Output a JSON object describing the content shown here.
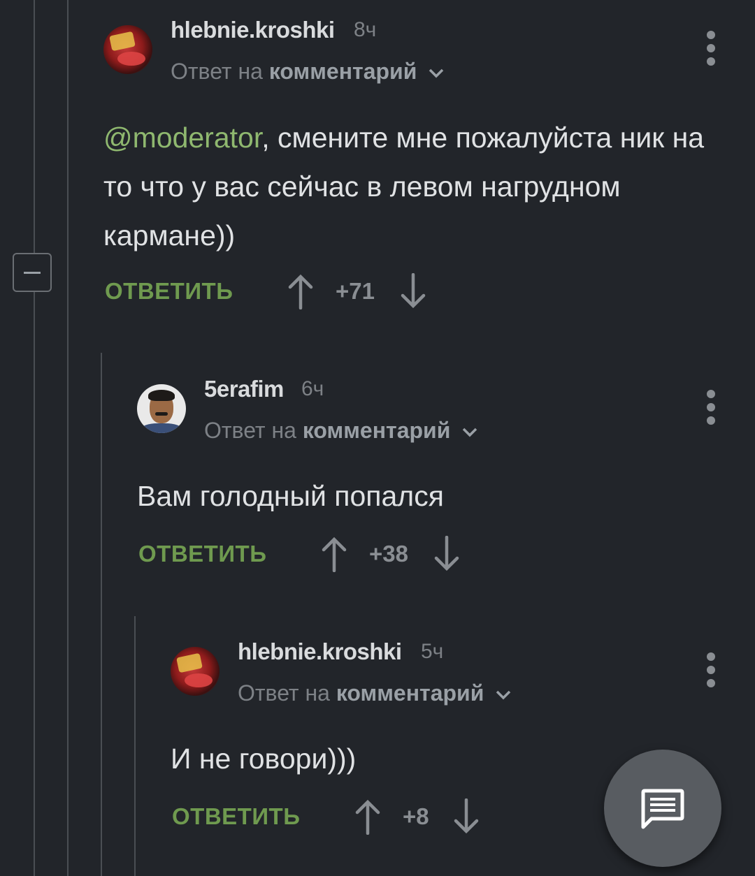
{
  "comments": [
    {
      "username": "hlebnie.kroshki",
      "time": "8ч",
      "reply_prefix": "Ответ на",
      "reply_target": "комментарий",
      "mention": "@moderator",
      "text": ", смените мне пожалуйста ник на то что у вас сейчас в левом нагрудном кармане))",
      "reply_label": "ОТВЕТИТЬ",
      "score": "+71",
      "avatar_icon": "noodle-avatar"
    },
    {
      "username": "5erafim",
      "time": "6ч",
      "reply_prefix": "Ответ на",
      "reply_target": "комментарий",
      "text": "Вам голодный попался",
      "reply_label": "ОТВЕТИТЬ",
      "score": "+38",
      "avatar_icon": "man-avatar"
    },
    {
      "username": "hlebnie.kroshki",
      "time": "5ч",
      "reply_prefix": "Ответ на",
      "reply_target": "комментарий",
      "text": "И не говори)))",
      "reply_label": "ОТВЕТИТЬ",
      "score": "+8",
      "avatar_icon": "noodle-avatar"
    }
  ],
  "colors": {
    "background": "#22252a",
    "accent_green": "#6f9a4f",
    "mention_green": "#8fb86f",
    "muted": "#7d8186"
  },
  "fab_icon": "comment-icon"
}
